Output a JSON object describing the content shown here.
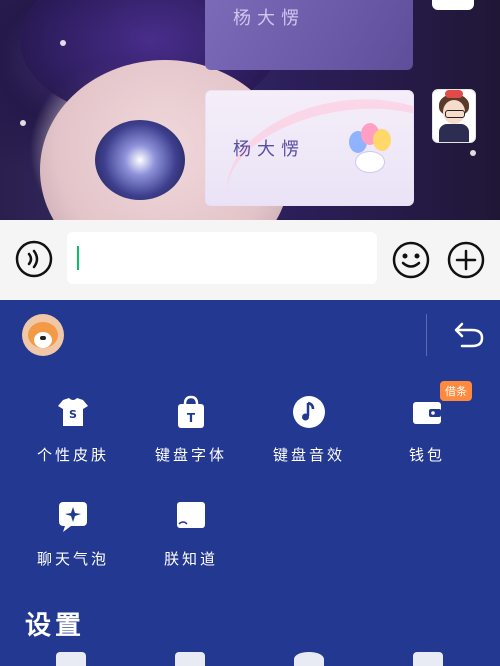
{
  "chat": {
    "bubble_top_text": "杨大愣",
    "bubble_main_text": "杨大愣"
  },
  "input_bar": {
    "placeholder": ""
  },
  "keyboard_panel": {
    "badge": "借条",
    "tiles": [
      {
        "label": "个性皮肤",
        "icon": "tshirt-icon"
      },
      {
        "label": "键盘字体",
        "icon": "font-bag-icon"
      },
      {
        "label": "键盘音效",
        "icon": "music-note-icon"
      },
      {
        "label": "钱包",
        "icon": "wallet-icon"
      },
      {
        "label": "聊天气泡",
        "icon": "sparkle-bubble-icon"
      },
      {
        "label": "朕知道",
        "icon": "stamp-icon"
      }
    ],
    "settings_title": "设置"
  },
  "colors": {
    "panel_bg": "#233891",
    "input_bar_bg": "#f5f5f5",
    "caret": "#07c160",
    "badge_bg": "#ff8a3d"
  }
}
